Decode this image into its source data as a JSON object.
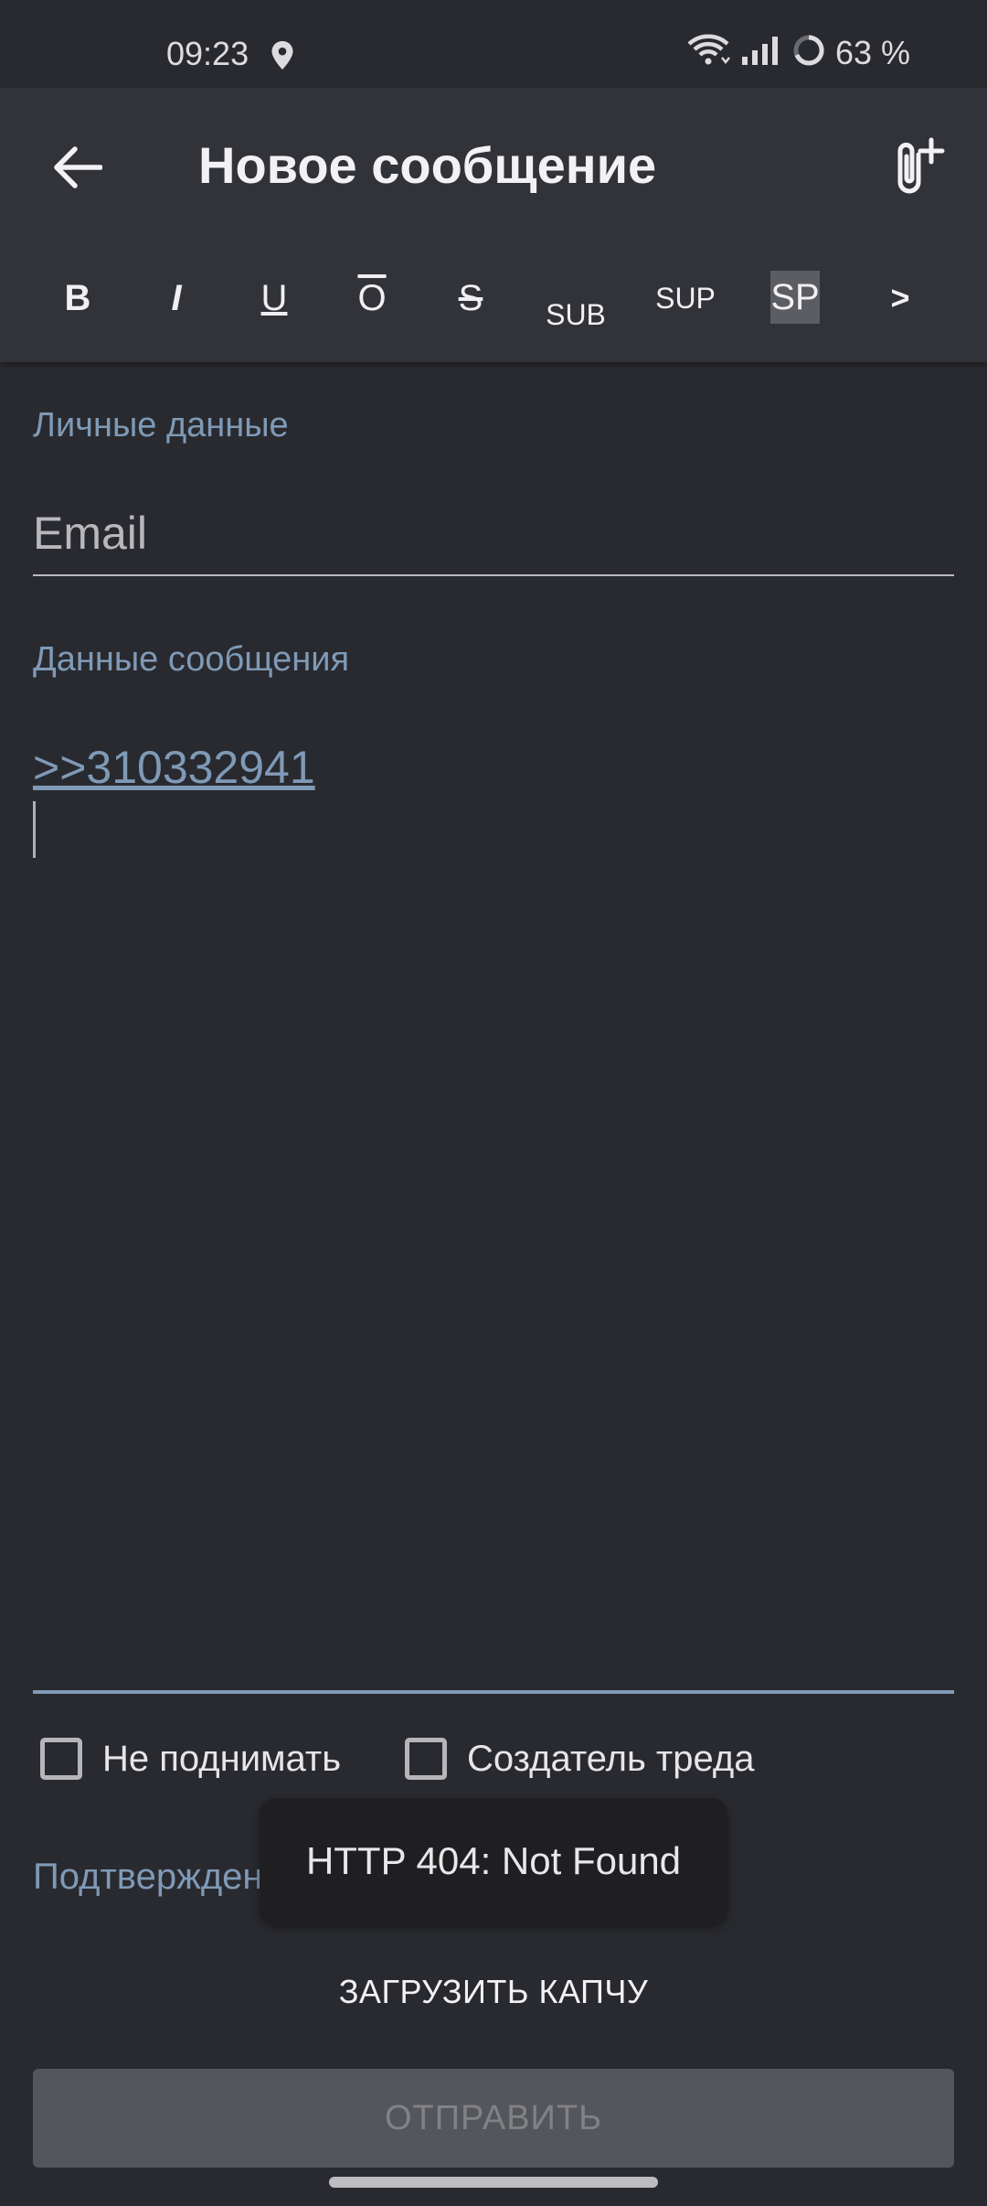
{
  "status_bar": {
    "time": "09:23",
    "battery_text": "63 %",
    "icons": [
      "location-icon",
      "wifi-icon",
      "signal-icon",
      "battery-ring-icon"
    ]
  },
  "app_bar": {
    "title": "Новое сообщение",
    "back_icon": "arrow-left-icon",
    "attach_icon": "attach-add-icon"
  },
  "format_toolbar": {
    "bold": "B",
    "italic": "I",
    "underline": "U",
    "overline": "O",
    "strike": "S",
    "sub": "SUB",
    "sup": "SUP",
    "spoiler": "SP",
    "more": ">"
  },
  "personal": {
    "section_label": "Личные данные",
    "email_placeholder": "Email",
    "email_value": ""
  },
  "message": {
    "section_label": "Данные сообщения",
    "reply_link": ">>310332941"
  },
  "options": {
    "no_bump_label": "Не поднимать",
    "no_bump_checked": false,
    "op_label": "Создатель треда",
    "op_checked": false
  },
  "confirm": {
    "section_label": "Подтверждение"
  },
  "toast": {
    "text": "HTTP 404: Not Found"
  },
  "captcha_button": "ЗАГРУЗИТЬ КАПЧУ",
  "send_button": "ОТПРАВИТЬ",
  "colors": {
    "background": "#292a2f",
    "appbar": "#323339",
    "accent": "#7f9ab7",
    "toast_bg": "#1f1f21",
    "send_disabled_bg": "#55565b"
  }
}
